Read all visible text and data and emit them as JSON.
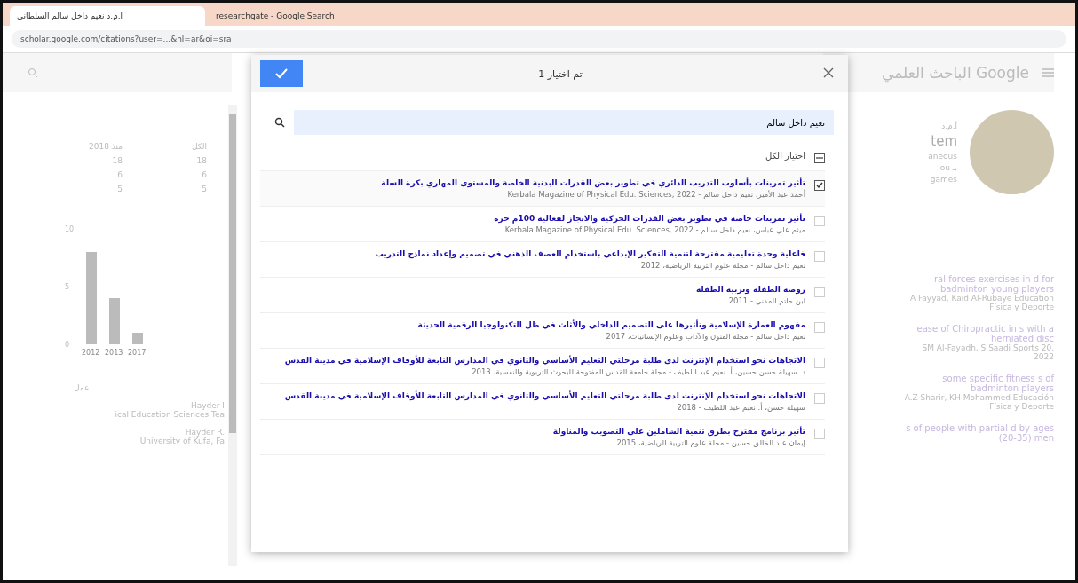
{
  "browser": {
    "first_tab": {
      "title": "أ.م.د نعيم داخل سالم السلطاني",
      "selected": true
    },
    "second_tab": {
      "title": "researchgate - Google Search",
      "selected": false
    },
    "address": "scholar.google.com/citations?user=...&hl=ar&oi=sra"
  },
  "profile_page": {
    "logo": "الباحث العلمي Google",
    "name_line": "أ.م.د",
    "name_cut": "tem",
    "info_lines": [
      "aneous",
      "ou بـ",
      "games"
    ],
    "stats": {
      "headers": [
        "الكل",
        "منذ 2018"
      ],
      "rows": [
        [
          "18",
          "18"
        ],
        [
          "6",
          "6"
        ],
        [
          "5",
          "5"
        ]
      ]
    },
    "chart_data": {
      "type": "bar",
      "categories": [
        "2012",
        "2013",
        "2017"
      ],
      "values": [
        8,
        4,
        1
      ],
      "yticks": [
        0,
        5,
        10
      ],
      "ylim": [
        0,
        10
      ]
    },
    "coauthors_label": "عمل",
    "coauthors": [
      {
        "name": "Hayder I",
        "affiliation": "ical Education Sciences Tea"
      },
      {
        "name": "Hayder R.",
        "affiliation": "University of Kufa, Fa"
      }
    ],
    "articles": [
      {
        "title": "ral forces exercises in d for badminton young players",
        "meta": "A Fayyad, Kaid Al-Rubaye Education Física y Deporte"
      },
      {
        "title": "ease of Chiropractic in s with a herniated disc",
        "meta": "SM Al-Fayadh, S Saadi Sports 20, 2022"
      },
      {
        "title": "some specific fitness s of badminton players",
        "meta": "A.Z Sharir, KH Mohammed Educación Física y Deporte"
      },
      {
        "title": "s of people with partial d by ages (20-35) men"
      }
    ]
  },
  "dialog": {
    "title": "تم اختيار 1",
    "search_value": "نعيم داخل سالم",
    "select_all": {
      "label": "اختيار الكل",
      "indeterminate": true
    },
    "items": [
      {
        "title": "تأثير تمرينات بأسلوب التدريب الدائري في تطوير بعض القدرات البدنية الخاصة والمستوى المهاري بكرة السلة",
        "meta": "أحمد عبد الأمير، نعيم داخل سالم - Kerbala Magazine of Physical Edu. Sciences, 2022",
        "checked": true
      },
      {
        "title": "تأثير تمرينات خاصة في تطوير بعض القدرات الحركية والانجاز لفعالية 100م حرة",
        "meta": "ميثم علي عباس، نعيم داخل سالم - Kerbala Magazine of Physical Edu. Sciences, 2022",
        "checked": false
      },
      {
        "title": "فاعلية وحدة تعليمية مقترحة لتنمية التفكير الإبداعي باستخدام العصف الذهني في تصميم وإعداد نماذج التدريب",
        "meta": "نعيم داخل سالم - مجلة علوم التربية الرياضية، 2012",
        "checked": false
      },
      {
        "title": "روضة الطفلة وتربية الطفلة",
        "meta": "ابن حاتم المدني - 2011",
        "checked": false
      },
      {
        "title": "مفهوم العمارة الإسلامية وتأثيرها على التصميم الداخلي والأثاث في ظل التكنولوجيا الرقمية الحديثة",
        "meta": "نعيم داخل سالم - مجلة الفنون والآداب وعلوم الإنسانيات، 2017",
        "checked": false
      },
      {
        "title": "الاتجاهات نحو استخدام الإنترنت لدى طلبة مرحلتي التعليم الأساسي والثانوي في المدارس التابعة للأوقاف الإسلامية في مدينة القدس",
        "meta": "د. سهيلة حسن حسين، أ. نعيم عبد اللطيف - مجلة جامعة القدس المفتوحة للبحوث التربوية والنفسية، 2013",
        "checked": false
      },
      {
        "title": "الاتجاهات نحو استخدام الإنترنت لدى طلبة مرحلتي التعليم الأساسي والثانوي في المدارس التابعة للأوقاف الإسلامية في مدينة القدس",
        "meta": "سهيلة حسن، أ. نعيم عبد اللطيف - 2018",
        "checked": false
      },
      {
        "title": "تأثير برنامج مقترح بطرق تنمية الشاملين على التصويب والمناولة",
        "meta": "إيمان عبد الخالق حسين - مجلة علوم التربية الرياضية، 2015",
        "checked": false
      }
    ]
  }
}
